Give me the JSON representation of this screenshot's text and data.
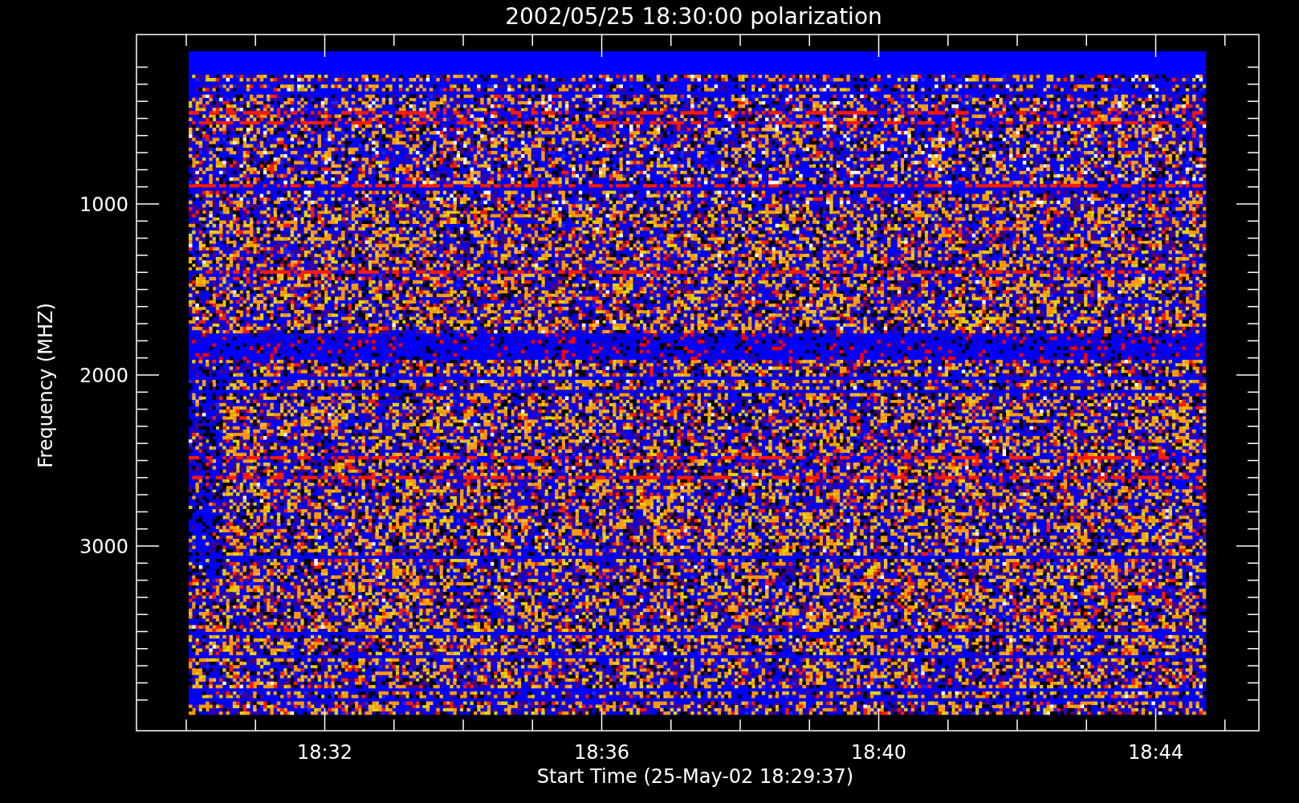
{
  "title": "2002/05/25 18:30:00 polarization",
  "y_axis": {
    "label": "Frequency (MHZ)",
    "ticks": [
      "1000",
      "2000",
      "3000"
    ]
  },
  "x_axis": {
    "label": "Start Time (25-May-02 18:29:37)",
    "ticks": [
      "18:32",
      "18:36",
      "18:40",
      "18:44"
    ]
  }
}
